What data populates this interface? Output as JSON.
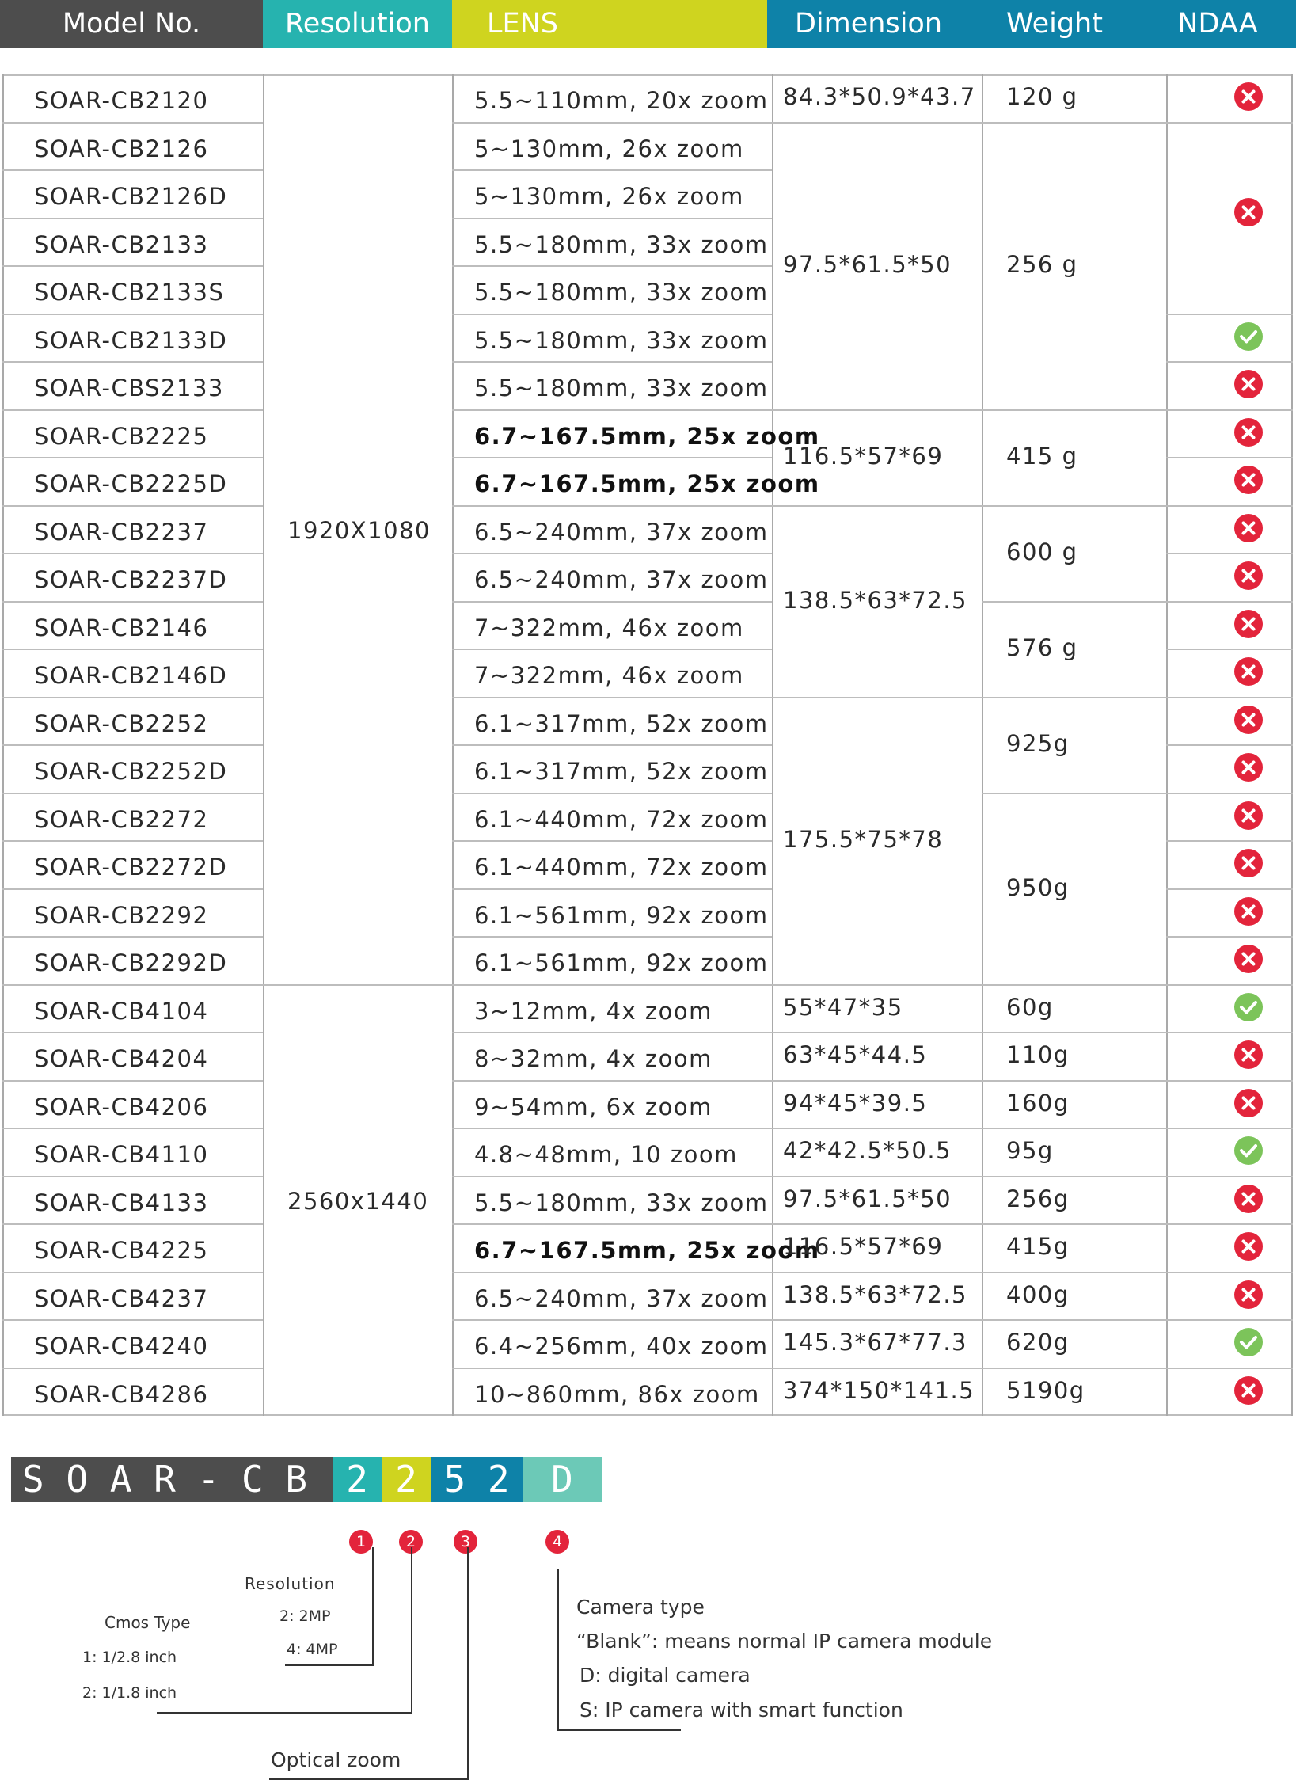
{
  "header": {
    "model_no": "Model No.",
    "resolution": "Resolution",
    "lens": "LENS",
    "dimension": "Dimension",
    "weight": "Weight",
    "ndaa": "NDAA",
    "colors": {
      "dark": "#4d4d4d",
      "teal": "#26b3af",
      "yellow": "#cfd41f",
      "blue": "#0e82a8"
    }
  },
  "resolutions": [
    "1920X1080",
    "2560x1440"
  ],
  "rows": [
    {
      "model": "SOAR-CB2120",
      "lens": "5.5~110mm, 20x zoom",
      "ndaa": "no"
    },
    {
      "model": "SOAR-CB2126",
      "lens": "5~130mm, 26x zoom",
      "ndaa": null
    },
    {
      "model": "SOAR-CB2126D",
      "lens": "5~130mm, 26x zoom",
      "ndaa": null
    },
    {
      "model": "SOAR-CB2133",
      "lens": "5.5~180mm, 33x zoom",
      "ndaa": null
    },
    {
      "model": "SOAR-CB2133S",
      "lens": "5.5~180mm, 33x zoom",
      "ndaa": null
    },
    {
      "model": "SOAR-CB2133D",
      "lens": "5.5~180mm, 33x zoom",
      "ndaa": "yes"
    },
    {
      "model": "SOAR-CBS2133",
      "lens": "5.5~180mm, 33x zoom",
      "ndaa": "no"
    },
    {
      "model": "SOAR-CB2225",
      "lens": "6.7~167.5mm, 25x zoom",
      "ndaa": "no",
      "bold": true
    },
    {
      "model": "SOAR-CB2225D",
      "lens": "6.7~167.5mm, 25x zoom",
      "ndaa": "no",
      "bold": true
    },
    {
      "model": "SOAR-CB2237",
      "lens": "6.5~240mm, 37x zoom",
      "ndaa": "no"
    },
    {
      "model": "SOAR-CB2237D",
      "lens": "6.5~240mm, 37x zoom",
      "ndaa": "no"
    },
    {
      "model": "SOAR-CB2146",
      "lens": "7~322mm, 46x zoom",
      "ndaa": "no"
    },
    {
      "model": "SOAR-CB2146D",
      "lens": "7~322mm, 46x zoom",
      "ndaa": "no"
    },
    {
      "model": "SOAR-CB2252",
      "lens": "6.1~317mm, 52x zoom",
      "ndaa": "no"
    },
    {
      "model": "SOAR-CB2252D",
      "lens": "6.1~317mm, 52x zoom",
      "ndaa": "no"
    },
    {
      "model": "SOAR-CB2272",
      "lens": "6.1~440mm, 72x zoom",
      "ndaa": "no"
    },
    {
      "model": "SOAR-CB2272D",
      "lens": "6.1~440mm, 72x zoom",
      "ndaa": "no"
    },
    {
      "model": "SOAR-CB2292",
      "lens": "6.1~561mm, 92x zoom",
      "ndaa": "no"
    },
    {
      "model": "SOAR-CB2292D",
      "lens": "6.1~561mm, 92x zoom",
      "ndaa": "no"
    },
    {
      "model": "SOAR-CB4104",
      "lens": "3~12mm, 4x zoom",
      "ndaa": "yes"
    },
    {
      "model": "SOAR-CB4204",
      "lens": "8~32mm, 4x zoom",
      "ndaa": "no"
    },
    {
      "model": "SOAR-CB4206",
      "lens": "9~54mm, 6x zoom",
      "ndaa": "no"
    },
    {
      "model": "SOAR-CB4110",
      "lens": "4.8~48mm, 10 zoom",
      "ndaa": "yes"
    },
    {
      "model": "SOAR-CB4133",
      "lens": "5.5~180mm, 33x zoom",
      "ndaa": "no"
    },
    {
      "model": "SOAR-CB4225",
      "lens": "6.7~167.5mm, 25x zoom",
      "ndaa": "no",
      "bold": true
    },
    {
      "model": "SOAR-CB4237",
      "lens": "6.5~240mm, 37x zoom",
      "ndaa": "no"
    },
    {
      "model": "SOAR-CB4240",
      "lens": "6.4~256mm, 40x zoom",
      "ndaa": "yes"
    },
    {
      "model": "SOAR-CB4286",
      "lens": "10~860mm, 86x zoom",
      "ndaa": "no"
    }
  ],
  "ndaa_merged": [
    {
      "rows": [
        1,
        4
      ],
      "value": "no"
    }
  ],
  "dimensions": [
    {
      "rows": [
        0,
        0
      ],
      "value": "84.3*50.9*43.7"
    },
    {
      "rows": [
        1,
        6
      ],
      "value": "97.5*61.5*50"
    },
    {
      "rows": [
        7,
        8
      ],
      "value": "116.5*57*69"
    },
    {
      "rows": [
        9,
        12
      ],
      "value": "138.5*63*72.5"
    },
    {
      "rows": [
        13,
        18
      ],
      "value": "175.5*75*78"
    },
    {
      "rows": [
        19,
        19
      ],
      "value": "55*47*35"
    },
    {
      "rows": [
        20,
        20
      ],
      "value": "63*45*44.5"
    },
    {
      "rows": [
        21,
        21
      ],
      "value": "94*45*39.5"
    },
    {
      "rows": [
        22,
        22
      ],
      "value": "42*42.5*50.5"
    },
    {
      "rows": [
        23,
        23
      ],
      "value": "97.5*61.5*50"
    },
    {
      "rows": [
        24,
        24
      ],
      "value": "116.5*57*69"
    },
    {
      "rows": [
        25,
        25
      ],
      "value": "138.5*63*72.5"
    },
    {
      "rows": [
        26,
        26
      ],
      "value": "145.3*67*77.3"
    },
    {
      "rows": [
        27,
        27
      ],
      "value": "374*150*141.5"
    }
  ],
  "weights": [
    {
      "rows": [
        0,
        0
      ],
      "value": "120 g"
    },
    {
      "rows": [
        1,
        6
      ],
      "value": "256 g"
    },
    {
      "rows": [
        7,
        8
      ],
      "value": "415 g"
    },
    {
      "rows": [
        9,
        10
      ],
      "value": "600 g"
    },
    {
      "rows": [
        11,
        12
      ],
      "value": "576 g"
    },
    {
      "rows": [
        13,
        14
      ],
      "value": "925g"
    },
    {
      "rows": [
        15,
        18
      ],
      "value": "950g"
    },
    {
      "rows": [
        19,
        19
      ],
      "value": "60g"
    },
    {
      "rows": [
        20,
        20
      ],
      "value": "110g"
    },
    {
      "rows": [
        21,
        21
      ],
      "value": "160g"
    },
    {
      "rows": [
        22,
        22
      ],
      "value": "95g"
    },
    {
      "rows": [
        23,
        23
      ],
      "value": "256g"
    },
    {
      "rows": [
        24,
        24
      ],
      "value": "415g"
    },
    {
      "rows": [
        25,
        25
      ],
      "value": "400g"
    },
    {
      "rows": [
        26,
        26
      ],
      "value": "620g"
    },
    {
      "rows": [
        27,
        27
      ],
      "value": "5190g"
    }
  ],
  "code": {
    "prefix": "S O A R - C B",
    "d1": "2",
    "d2": "2",
    "d3": "5 2",
    "d4": "D",
    "markers": [
      "1",
      "2",
      "3",
      "4"
    ],
    "resolution_title": "Resolution",
    "res_opt1": "2: 2MP",
    "res_opt2": "4: 4MP",
    "cmos_title": "Cmos Type",
    "cmos_opt1": "1:   1/2.8 inch",
    "cmos_opt2": "2:   1/1.8 inch",
    "optical_zoom": "Optical zoom",
    "camera_type": "Camera type",
    "ct_blank": "“Blank”:  means normal IP camera module",
    "ct_d": "D: digital camera",
    "ct_s": "S: IP camera with smart function",
    "colors": {
      "grey": "#4d4d4d",
      "teal": "#26b3af",
      "yellow": "#cfd41f",
      "blue": "#0e82a8",
      "mint": "#6cc9b7"
    }
  }
}
